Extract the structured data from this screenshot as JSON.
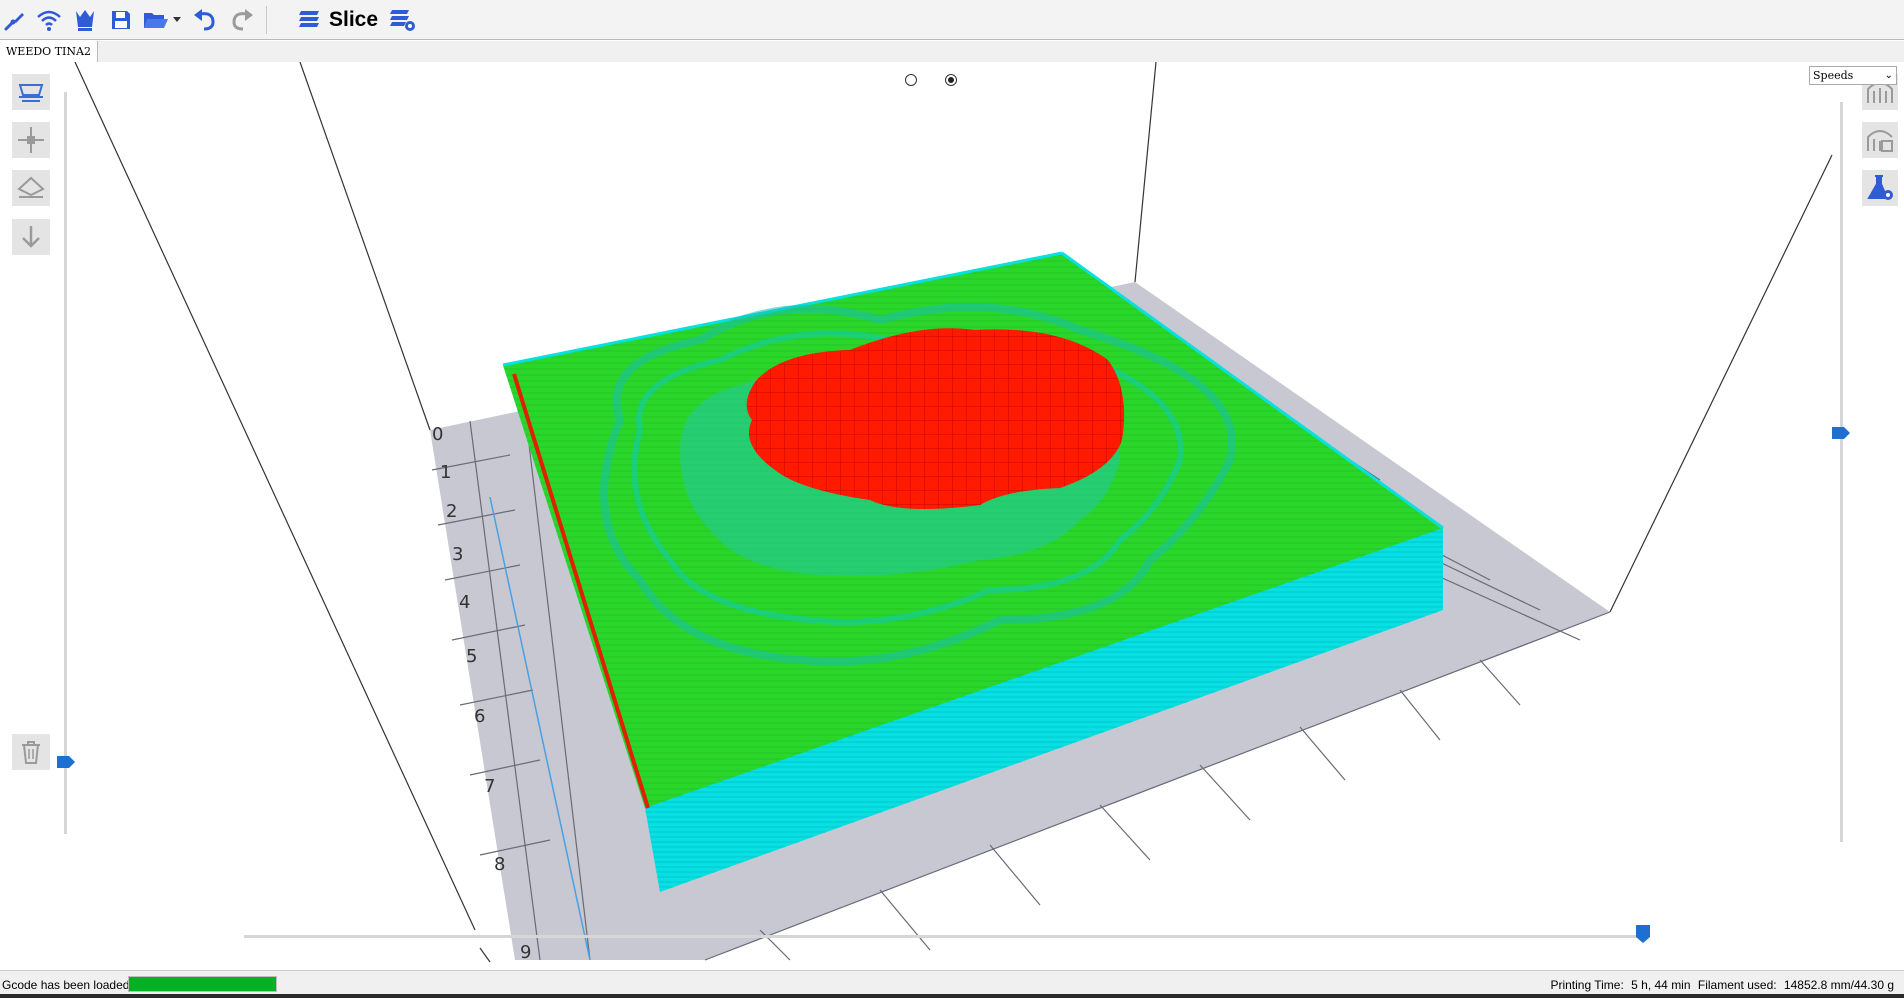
{
  "toolbar": {
    "buttons": [
      {
        "name": "connect-icon",
        "label": ""
      },
      {
        "name": "wifi-icon",
        "label": ""
      },
      {
        "name": "plugins-icon",
        "label": ""
      },
      {
        "name": "save-icon",
        "label": ""
      },
      {
        "name": "open-folder-icon",
        "label": ""
      },
      {
        "name": "undo-icon",
        "label": ""
      },
      {
        "name": "redo-icon",
        "label": ""
      }
    ],
    "slice_label": "Slice"
  },
  "tabs": [
    {
      "label": "WEEDO TINA2"
    }
  ],
  "view_mode": {
    "selected_index": 1
  },
  "left_tools": [
    "rotate-view-icon",
    "move-icon",
    "lay-flat-icon",
    "drop-to-bed-icon"
  ],
  "delete_icon": "trash-icon",
  "right_tools": [
    "support-icon",
    "remove-support-icon",
    "flask-settings-icon"
  ],
  "layer_combo": {
    "value": "Speeds",
    "options": [
      "Speeds"
    ]
  },
  "bed": {
    "ruler_numbers": [
      "0",
      "1",
      "2",
      "3",
      "4",
      "5",
      "6",
      "7",
      "8",
      "9"
    ]
  },
  "sliders": {
    "right_layer_fraction": 0.5,
    "left_layer_fraction": 0.0,
    "move_fraction": 0.95
  },
  "colors": {
    "accent": "#1f6fd1",
    "icon_blue": "#2f5bd6",
    "model_top": "#2ad62a",
    "model_side": "#06e0e0",
    "infill": "#ff1a00",
    "bed": "#c8c8d2",
    "progress": "#06b025"
  },
  "status": {
    "message": "Gcode has been loaded",
    "progress_percent": 100,
    "printing_time_label": "Printing Time:",
    "printing_time_value": "5 h, 44 min",
    "filament_label": "Filament used:",
    "filament_value": "14852.8 mm/44.30 g"
  }
}
